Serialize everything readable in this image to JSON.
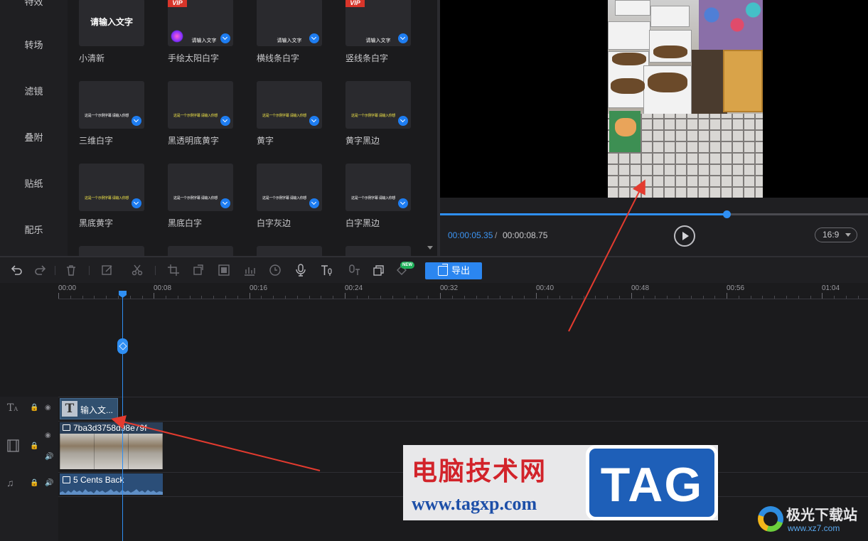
{
  "sidebar": {
    "items": [
      "特效",
      "转场",
      "滤镜",
      "叠附",
      "贴纸",
      "配乐"
    ]
  },
  "templates": [
    {
      "label": "小清新",
      "thumb": "请输入文字",
      "vip": false,
      "style": "big"
    },
    {
      "label": "手绘太阳白字",
      "thumb": "请输入文字",
      "vip": true,
      "vip_text": "VIP",
      "style": "sun"
    },
    {
      "label": "横线条白字",
      "thumb": "请输入文字",
      "vip": false,
      "style": "small"
    },
    {
      "label": "竖线条白字",
      "thumb": "请输入文字",
      "vip": true,
      "vip_text": "VIP",
      "style": "small"
    },
    {
      "label": "三维白字",
      "thumb": "这是一个示例字幕 请输入你想要的文字",
      "style": "line"
    },
    {
      "label": "黑透明底黄字",
      "thumb": "这是一个示例字幕 请输入你想要的文字",
      "style": "yellow"
    },
    {
      "label": "黄字",
      "thumb": "这是一个示例字幕 请输入你想要的文字",
      "style": "yellow"
    },
    {
      "label": "黄字黑边",
      "thumb": "这是一个示例字幕 请输入你想要的文字",
      "style": "yellow"
    },
    {
      "label": "黑底黄字",
      "thumb": "这是一个示例字幕 请输入你想要的文字",
      "style": "yellow"
    },
    {
      "label": "黑底白字",
      "thumb": "这是一个示例字幕 请输入你想要的文字",
      "style": "line"
    },
    {
      "label": "白字灰边",
      "thumb": "这是一个示例字幕 请输入你想要的文字",
      "style": "line"
    },
    {
      "label": "白字黑边",
      "thumb": "这是一个示例字幕 请输入你想要的文字",
      "style": "line"
    }
  ],
  "preview": {
    "current_time": "00:00:05.35",
    "separator": "/",
    "total_time": "00:00:08.75",
    "progress_fraction": 0.67,
    "aspect_ratio": "16:9"
  },
  "toolbar": {
    "icons": [
      "undo-icon",
      "redo-icon",
      "delete-icon",
      "edit-icon",
      "cut-icon",
      "crop-icon",
      "rotate-icon",
      "mosaic-icon",
      "freeze-icon",
      "duration-icon",
      "record-icon",
      "text-to-speech-icon",
      "speech-to-text-icon",
      "overlay-icon",
      "new-feature-icon"
    ],
    "new_badge": "NEW",
    "export_label": "导出"
  },
  "timeline": {
    "ruler_labels": [
      "00:00",
      "00:08",
      "00:16",
      "00:24",
      "00:32",
      "00:40",
      "00:48",
      "00:56",
      "01:04"
    ],
    "text_clip": "输入文...",
    "video_clip": "7ba3d3758d98e79f",
    "audio_clip": "5 Cents Back"
  },
  "watermark": {
    "title": "电脑技术网",
    "url": "www.tagxp.com",
    "tag": "TAG"
  },
  "site_logo": {
    "name": "极光下载站",
    "url": "www.xz7.com"
  },
  "colors": {
    "accent": "#2f8ff3",
    "export_button": "#2b86f0",
    "arrow": "#e43b2f",
    "background": "#1b1b1d"
  }
}
